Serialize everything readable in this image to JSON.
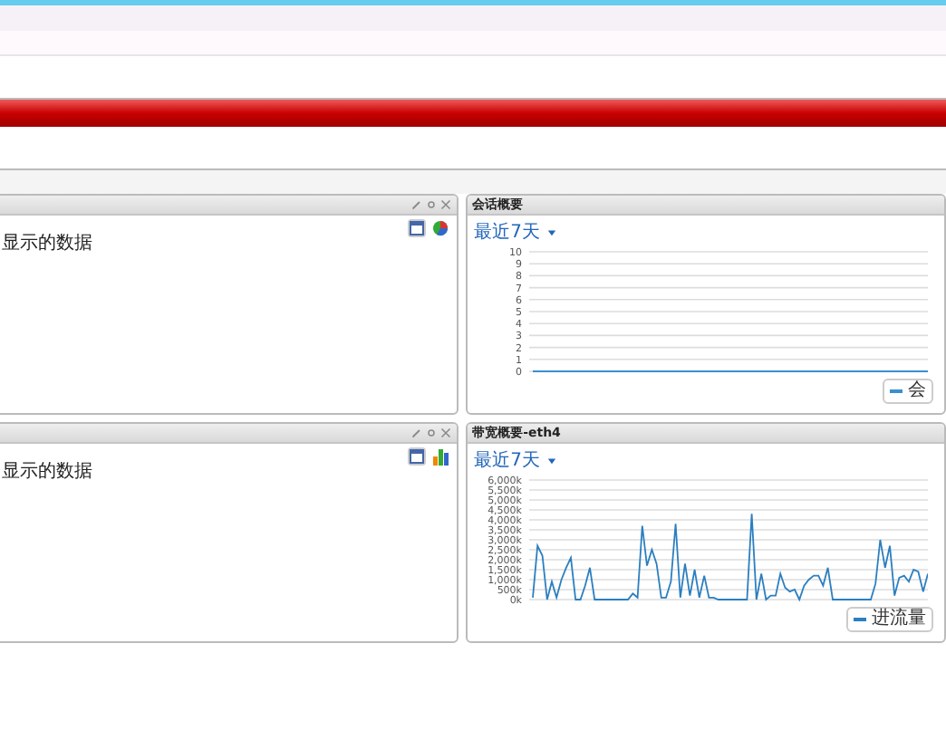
{
  "left_panels": [
    {
      "message": "显示的数据",
      "kind": "pie"
    },
    {
      "message": "显示的数据",
      "kind": "bar"
    }
  ],
  "right_panels": [
    {
      "title": "会话概要",
      "range": "最近7天",
      "chart_data": {
        "type": "line",
        "grid": true,
        "ylim": [
          0,
          10
        ],
        "yticks": [
          0,
          1,
          2,
          3,
          4,
          5,
          6,
          7,
          8,
          9,
          10
        ],
        "series": [
          {
            "name": "会",
            "color": "#3a8fd0",
            "values": [
              0,
              0,
              0,
              0,
              0,
              0,
              0,
              0,
              0,
              0,
              0,
              0,
              0,
              0,
              0,
              0,
              0,
              0,
              0,
              0,
              0,
              0,
              0,
              0,
              0,
              0,
              0,
              0,
              0,
              0,
              0,
              0,
              0,
              0,
              0,
              0,
              0,
              0,
              0,
              0
            ]
          }
        ]
      }
    },
    {
      "title": "带宽概要-eth4",
      "range": "最近7天",
      "chart_data": {
        "type": "line",
        "grid": true,
        "ylim": [
          0,
          6000
        ],
        "yticks": [
          {
            "value": 0,
            "label": "0k"
          },
          {
            "value": 500,
            "label": "500k"
          },
          {
            "value": 1000,
            "label": "1,000k"
          },
          {
            "value": 1500,
            "label": "1,500k"
          },
          {
            "value": 2000,
            "label": "2,000k"
          },
          {
            "value": 2500,
            "label": "2,500k"
          },
          {
            "value": 3000,
            "label": "3,000k"
          },
          {
            "value": 3500,
            "label": "3,500k"
          },
          {
            "value": 4000,
            "label": "4,000k"
          },
          {
            "value": 4500,
            "label": "4,500k"
          },
          {
            "value": 5000,
            "label": "5,000k"
          },
          {
            "value": 5500,
            "label": "5,500k"
          },
          {
            "value": 6000,
            "label": "6,000k"
          }
        ],
        "series": [
          {
            "name": "进流量",
            "color": "#2b7fc0",
            "values": [
              100,
              2700,
              2200,
              0,
              900,
              100,
              1000,
              1600,
              2100,
              0,
              0,
              700,
              1600,
              0,
              0,
              0,
              0,
              0,
              0,
              0,
              0,
              300,
              100,
              3700,
              1700,
              2500,
              1800,
              100,
              100,
              900,
              3800,
              100,
              1800,
              200,
              1500,
              100,
              1200,
              100,
              100,
              0,
              0,
              0,
              0,
              0,
              0,
              0,
              4300,
              0,
              1300,
              0,
              200,
              200,
              1300,
              600,
              400,
              500,
              0,
              700,
              1000,
              1200,
              1200,
              700,
              1600,
              0,
              0,
              0,
              0,
              0,
              0,
              0,
              0,
              0,
              800,
              3000,
              1600,
              2700,
              200,
              1100,
              1200,
              900,
              1500,
              1400,
              400,
              1300
            ]
          }
        ]
      }
    }
  ]
}
